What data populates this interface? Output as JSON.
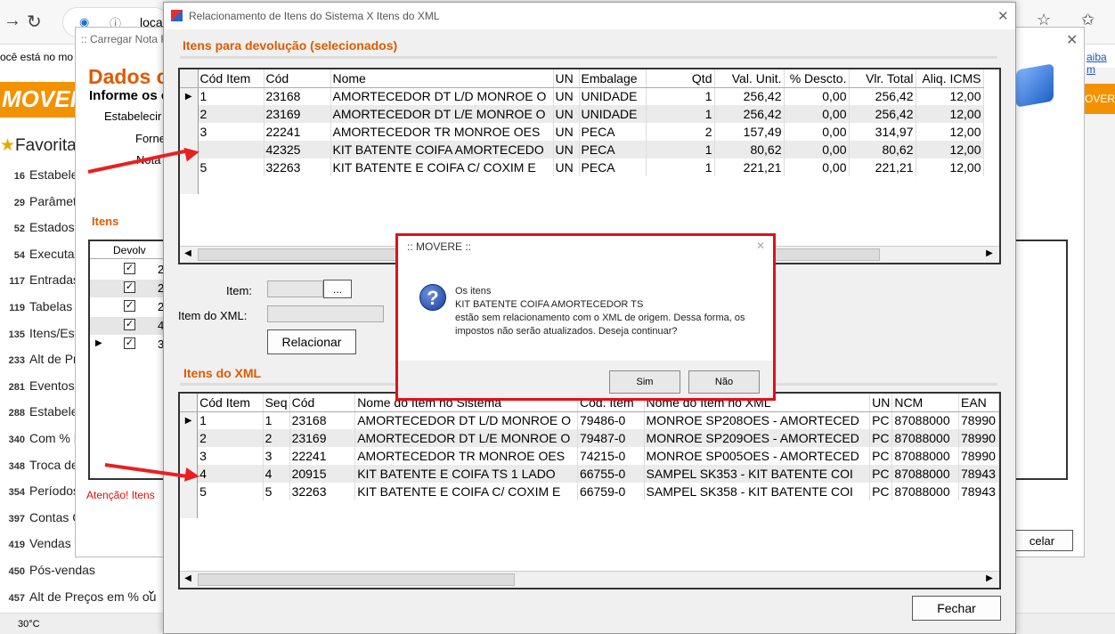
{
  "browser": {
    "address": "local",
    "notice": "ocê está no mo",
    "notice_right": "aiba m",
    "weather": "30°C"
  },
  "bg": {
    "window_title": ":: Carregar Nota F",
    "header": "Dados c",
    "subheader": "Informe os c",
    "labels": [
      "Estabelecir",
      "Forne",
      "Nota"
    ],
    "itens_title": "Itens",
    "devolv_header": "Devolv",
    "devolv_rows": [
      "2",
      "2",
      "2",
      "4",
      "3"
    ],
    "attention": "Atenção! Itens",
    "cancel_label": "celar",
    "logo": "MOVERE",
    "logo_right": "OVER",
    "favorites": "Favorita",
    "sidebar": [
      {
        "n": "16",
        "t": "Estabele"
      },
      {
        "n": "29",
        "t": "Parâmetr"
      },
      {
        "n": "52",
        "t": "Estados"
      },
      {
        "n": "54",
        "t": "Executa"
      },
      {
        "n": "117",
        "t": "Entradas"
      },
      {
        "n": "119",
        "t": "Tabelas c"
      },
      {
        "n": "135",
        "t": "Itens/Esta"
      },
      {
        "n": "233",
        "t": "Alt de Pre"
      },
      {
        "n": "281",
        "t": "Eventos"
      },
      {
        "n": "288",
        "t": "Estabele"
      },
      {
        "n": "340",
        "t": "Com % D"
      },
      {
        "n": "348",
        "t": "Troca de"
      },
      {
        "n": "354",
        "t": "Períodos"
      },
      {
        "n": "397",
        "t": "Contas C"
      },
      {
        "n": "419",
        "t": "Vendas V"
      },
      {
        "n": "450",
        "t": "Pós-vendas"
      },
      {
        "n": "457",
        "t": "Alt de Preços em % ou"
      }
    ]
  },
  "dialog": {
    "title": "Relacionamento de Itens do Sistema X Itens do XML",
    "section1": "Itens para devolução (selecionados)",
    "section2": "Itens do XML",
    "item_label": "Item:",
    "item_xml_label": "Item do XML:",
    "browse_label": "...",
    "relacionar_label": "Relacionar",
    "fechar_label": "Fechar",
    "grid1": {
      "headers": [
        "Cód Item",
        "Cód",
        "Nome",
        "UN",
        "Embalage",
        "Qtd",
        "Val. Unit.",
        "% Descto.",
        "Vlr. Total",
        "Aliq. ICMS"
      ],
      "rows": [
        [
          "1",
          "23168",
          "AMORTECEDOR DT L/D MONROE O",
          "UN",
          "UNIDADE",
          "1",
          "256,42",
          "0,00",
          "256,42",
          "12,00"
        ],
        [
          "2",
          "23169",
          "AMORTECEDOR DT L/E MONROE O",
          "UN",
          "UNIDADE",
          "1",
          "256,42",
          "0,00",
          "256,42",
          "12,00"
        ],
        [
          "3",
          "22241",
          "AMORTECEDOR TR MONROE OES",
          "UN",
          "PECA",
          "2",
          "157,49",
          "0,00",
          "314,97",
          "12,00"
        ],
        [
          "",
          "42325",
          "KIT BATENTE COIFA AMORTECEDO",
          "UN",
          "PECA",
          "1",
          "80,62",
          "0,00",
          "80,62",
          "12,00"
        ],
        [
          "5",
          "32263",
          "KIT BATENTE E COIFA C/ COXIM E",
          "UN",
          "PECA",
          "1",
          "221,21",
          "0,00",
          "221,21",
          "12,00"
        ]
      ]
    },
    "grid2": {
      "headers": [
        "Cód Item",
        "Seq",
        "Cód",
        "Nome do Item no Sistema",
        "Cód. Item",
        "Nome do Item no XML",
        "UN",
        "NCM",
        "EAN"
      ],
      "rows": [
        [
          "1",
          "1",
          "23168",
          "AMORTECEDOR DT L/D MONROE O",
          "79486-0",
          "MONROE SP208OES - AMORTECED",
          "PC",
          "87088000",
          "78990"
        ],
        [
          "2",
          "2",
          "23169",
          "AMORTECEDOR DT L/E MONROE O",
          "79487-0",
          "MONROE SP209OES - AMORTECED",
          "PC",
          "87088000",
          "78990"
        ],
        [
          "3",
          "3",
          "22241",
          "AMORTECEDOR TR MONROE OES",
          "74215-0",
          "MONROE SP005OES - AMORTECED",
          "PC",
          "87088000",
          "78990"
        ],
        [
          "4",
          "4",
          "20915",
          "KIT BATENTE E COIFA TS 1 LADO",
          "66755-0",
          "SAMPEL SK353 - KIT BATENTE COI",
          "PC",
          "87088000",
          "78943"
        ],
        [
          "5",
          "5",
          "32263",
          "KIT BATENTE E COIFA C/ COXIM E",
          "66759-0",
          "SAMPEL SK358 - KIT BATENTE COI",
          "PC",
          "87088000",
          "78943"
        ]
      ]
    }
  },
  "message": {
    "title": ":: MOVERE ::",
    "lines": [
      "Os itens",
      "KIT BATENTE COIFA AMORTECEDOR TS",
      "estão sem relacionamento com o XML de origem. Dessa forma, os",
      "impostos não serão atualizados. Deseja continuar?"
    ],
    "yes": "Sim",
    "no": "Não"
  }
}
